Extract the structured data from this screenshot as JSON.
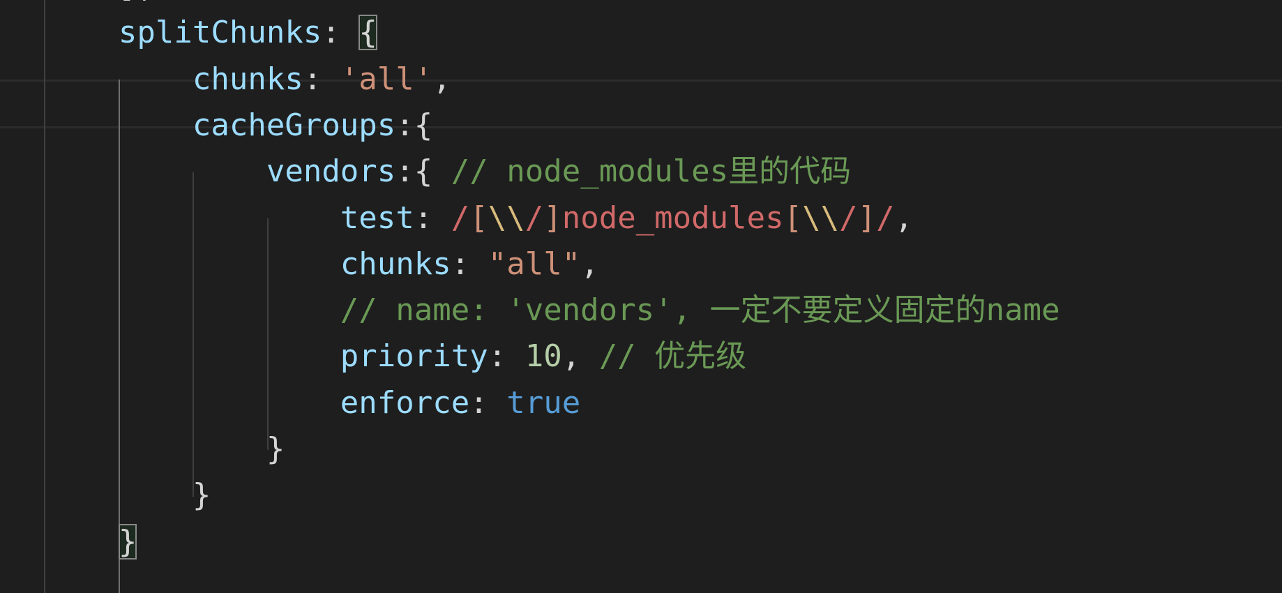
{
  "editor": {
    "theme_colors": {
      "background": "#1e1e1e",
      "property": "#9cdcfe",
      "string": "#ce9178",
      "comment": "#6a9955",
      "number": "#b5cea8",
      "keyword": "#569cd6",
      "regex": "#d16969"
    },
    "lines": [
      [
        {
          "text": "        ],",
          "kind": "punct"
        }
      ],
      [
        {
          "text": "        splitChunks",
          "kind": "key"
        },
        {
          "text": ": ",
          "kind": "punct"
        },
        {
          "text": "{",
          "kind": "bracket-match"
        }
      ],
      [
        {
          "text": "            chunks",
          "kind": "key"
        },
        {
          "text": ": ",
          "kind": "punct"
        },
        {
          "text": "'all'",
          "kind": "string"
        },
        {
          "text": ",",
          "kind": "punct"
        }
      ],
      [
        {
          "text": "            cacheGroups",
          "kind": "key"
        },
        {
          "text": ":{",
          "kind": "punct"
        }
      ],
      [
        {
          "text": "                vendors",
          "kind": "key"
        },
        {
          "text": ":{ ",
          "kind": "punct"
        },
        {
          "text": "// node_modules里的代码",
          "kind": "comment"
        }
      ],
      [
        {
          "text": "                    test",
          "kind": "key"
        },
        {
          "text": ": ",
          "kind": "punct"
        },
        {
          "text": "/",
          "kind": "regex"
        },
        {
          "text": "[",
          "kind": "regex-class"
        },
        {
          "text": "\\\\",
          "kind": "regex-escape"
        },
        {
          "text": "/",
          "kind": "regex"
        },
        {
          "text": "]",
          "kind": "regex-class"
        },
        {
          "text": "node_modules",
          "kind": "regex"
        },
        {
          "text": "[",
          "kind": "regex-class"
        },
        {
          "text": "\\\\",
          "kind": "regex-escape"
        },
        {
          "text": "/",
          "kind": "regex"
        },
        {
          "text": "]",
          "kind": "regex-class"
        },
        {
          "text": "/",
          "kind": "regex"
        },
        {
          "text": ",",
          "kind": "punct"
        }
      ],
      [
        {
          "text": "                    chunks",
          "kind": "key"
        },
        {
          "text": ": ",
          "kind": "punct"
        },
        {
          "text": "\"all\"",
          "kind": "string"
        },
        {
          "text": ",",
          "kind": "punct"
        }
      ],
      [
        {
          "text": "                    // name: 'vendors', 一定不要定义固定的name",
          "kind": "comment"
        }
      ],
      [
        {
          "text": "                    priority",
          "kind": "key"
        },
        {
          "text": ": ",
          "kind": "punct"
        },
        {
          "text": "10",
          "kind": "number"
        },
        {
          "text": ", ",
          "kind": "punct"
        },
        {
          "text": "// 优先级",
          "kind": "comment"
        }
      ],
      [
        {
          "text": "                    enforce",
          "kind": "key"
        },
        {
          "text": ": ",
          "kind": "punct"
        },
        {
          "text": "true",
          "kind": "bool"
        }
      ],
      [
        {
          "text": "                }",
          "kind": "punct"
        }
      ],
      [
        {
          "text": "            }",
          "kind": "punct"
        }
      ],
      [
        {
          "text": "        ",
          "kind": "punct"
        },
        {
          "text": "}",
          "kind": "bracket-match"
        }
      ]
    ]
  }
}
